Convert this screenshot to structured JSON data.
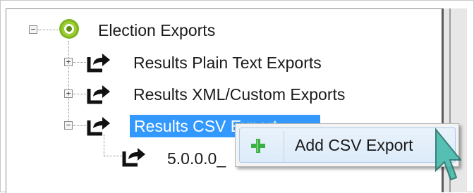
{
  "tree": {
    "root": {
      "label": "Election Exports",
      "icon": "green-target-icon",
      "expander": "−"
    },
    "children": [
      {
        "label": "Results Plain Text Exports",
        "icon": "export-arrow-icon",
        "expander": "+"
      },
      {
        "label": "Results XML/Custom Exports",
        "icon": "export-arrow-icon",
        "expander": "+"
      },
      {
        "label": "Results CSV Exports",
        "visible_label": "Results CSV Export",
        "icon": "export-arrow-icon",
        "expander": "−",
        "selected": true,
        "children": [
          {
            "label": "5.0.0.0_",
            "icon": "export-arrow-icon"
          }
        ]
      }
    ]
  },
  "context_menu": {
    "items": [
      {
        "label": "Add CSV Export",
        "icon": "green-plus-icon"
      }
    ]
  },
  "colors": {
    "selection": "#3399ff",
    "menu_highlight": "#dcebfa",
    "plus_green": "#3cb043",
    "cursor": "#3fb8a8"
  }
}
